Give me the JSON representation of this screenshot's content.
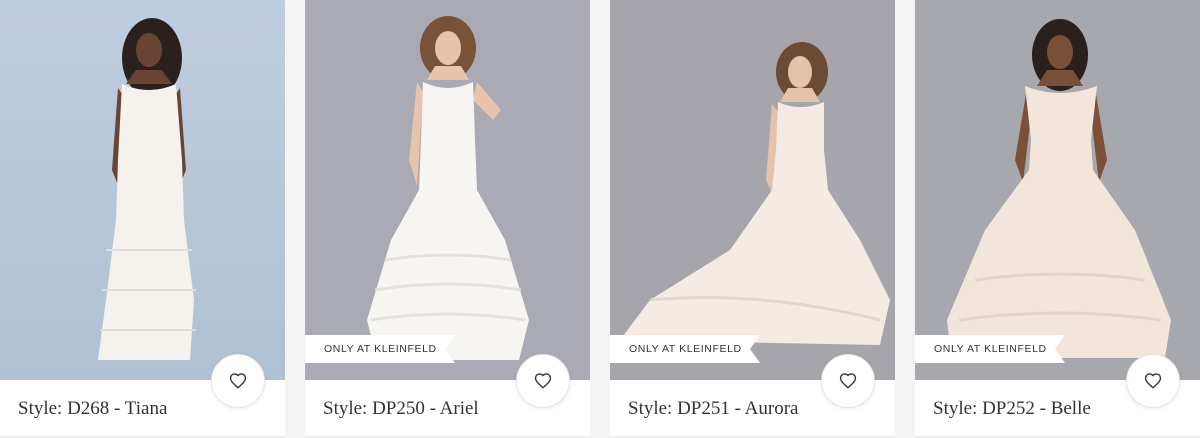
{
  "products": [
    {
      "style_label": "Style: D268 - Tiana",
      "badge": "",
      "favorite_icon": "heart-outline-icon",
      "background_color": "#b6c6d9",
      "dress_color": "#f5f1ec"
    },
    {
      "style_label": "Style: DP250 - Ariel",
      "badge": "ONLY AT KLEINFELD",
      "favorite_icon": "heart-outline-icon",
      "background_color": "#a9aab2",
      "dress_color": "#f7f5f2"
    },
    {
      "style_label": "Style: DP251 - Aurora",
      "badge": "ONLY AT KLEINFELD",
      "favorite_icon": "heart-outline-icon",
      "background_color": "#a4a4aa",
      "dress_color": "#f3ebe4"
    },
    {
      "style_label": "Style: DP252 - Belle",
      "badge": "ONLY AT KLEINFELD",
      "favorite_icon": "heart-outline-icon",
      "background_color": "#a6a6ad",
      "dress_color": "#f2e6dc"
    }
  ]
}
